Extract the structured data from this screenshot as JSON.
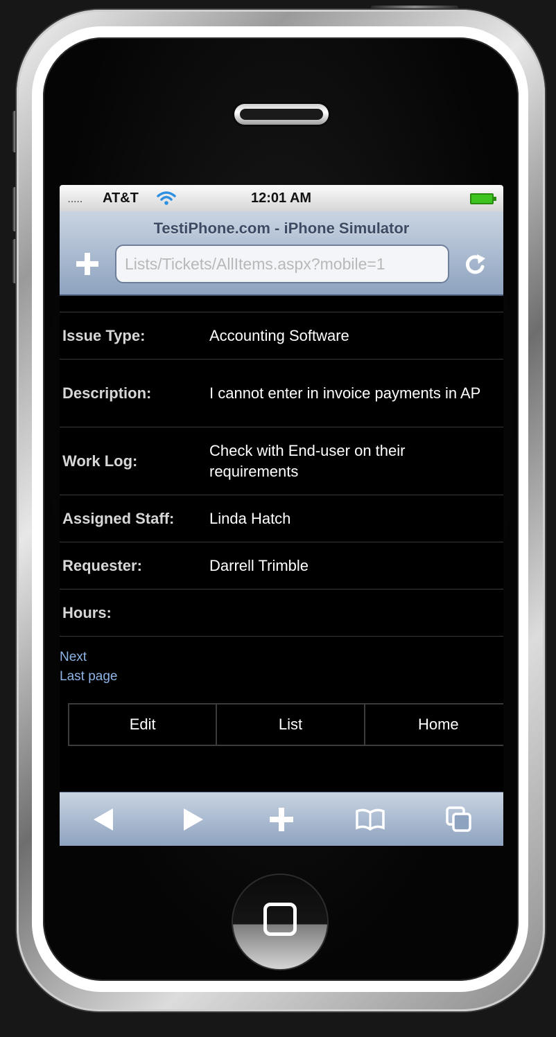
{
  "status_bar": {
    "signal": ".....",
    "carrier": "AT&T",
    "time": "12:01 AM",
    "battery_color": "#3ec420"
  },
  "browser": {
    "title": "TestiPhone.com - iPhone Simulator",
    "url": "Lists/Tickets/AllItems.aspx?mobile=1",
    "add_icon": "plus-icon",
    "reload_icon": "reload-icon"
  },
  "fields": [
    {
      "label": "Issue Type:",
      "value": "Accounting Software"
    },
    {
      "label": "Description:",
      "value": "I cannot enter in invoice payments in AP"
    },
    {
      "label": "Work Log:",
      "value": "Check with End-user on their requirements"
    },
    {
      "label": "Assigned Staff:",
      "value": "Linda Hatch"
    },
    {
      "label": "Requester:",
      "value": "Darrell Trimble"
    },
    {
      "label": "Hours:",
      "value": ""
    }
  ],
  "pager": {
    "next": "Next",
    "last": "Last page"
  },
  "actions": {
    "edit": "Edit",
    "list": "List",
    "home": "Home"
  },
  "toolbar": {
    "icons": [
      "back-arrow-icon",
      "forward-arrow-icon",
      "plus-icon",
      "bookmarks-icon",
      "pages-icon"
    ]
  },
  "colors": {
    "link": "#8fb5e8",
    "chrome": "#8ea3bf",
    "screen_bg": "#000000"
  }
}
